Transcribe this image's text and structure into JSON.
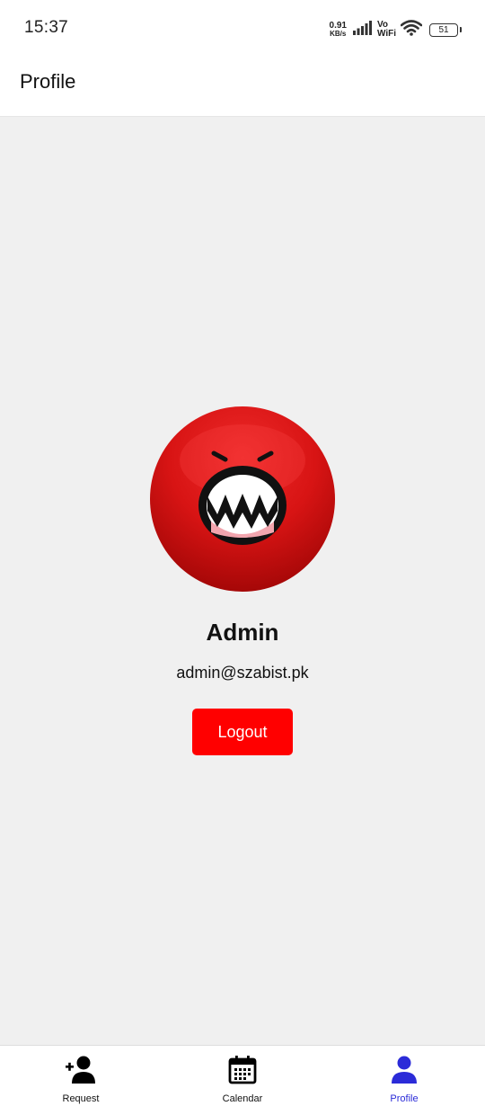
{
  "status_bar": {
    "time": "15:37",
    "net_speed_value": "0.91",
    "net_speed_unit": "KB/s",
    "vo_label": "Vo",
    "wifi_label": "WiFi",
    "battery_level": "51"
  },
  "app_bar": {
    "title": "Profile"
  },
  "profile": {
    "name": "Admin",
    "email": "admin@szabist.pk",
    "logout_label": "Logout",
    "avatar_icon": "angry-red-face-avatar"
  },
  "bottom_nav": {
    "items": [
      {
        "label": "Request",
        "icon": "add-person-icon",
        "active": false
      },
      {
        "label": "Calendar",
        "icon": "calendar-icon",
        "active": false
      },
      {
        "label": "Profile",
        "icon": "person-icon",
        "active": true
      }
    ]
  },
  "colors": {
    "accent_active": "#2b2bd8",
    "logout_bg": "#ff0000",
    "background": "#f0f0f0"
  }
}
